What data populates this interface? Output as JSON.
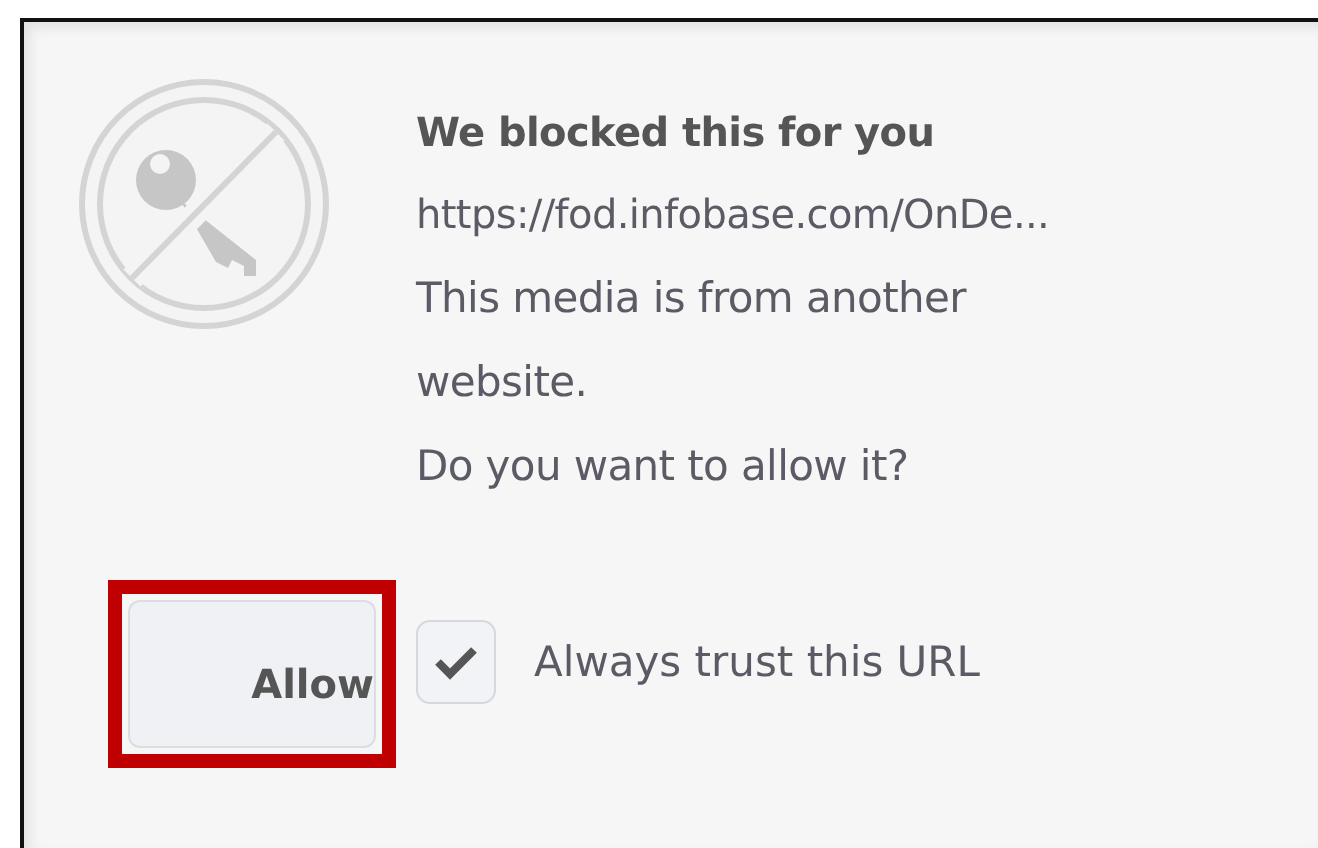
{
  "dialog": {
    "title": "We blocked this for you",
    "url": "https://fod.infobase.com/OnDe...",
    "message": "This media is from another website.",
    "question": "Do you want to allow it?",
    "allow_button": {
      "label": "Allow",
      "highlighted": true
    },
    "trust_checkbox": {
      "label": "Always trust this URL",
      "checked": true
    }
  }
}
